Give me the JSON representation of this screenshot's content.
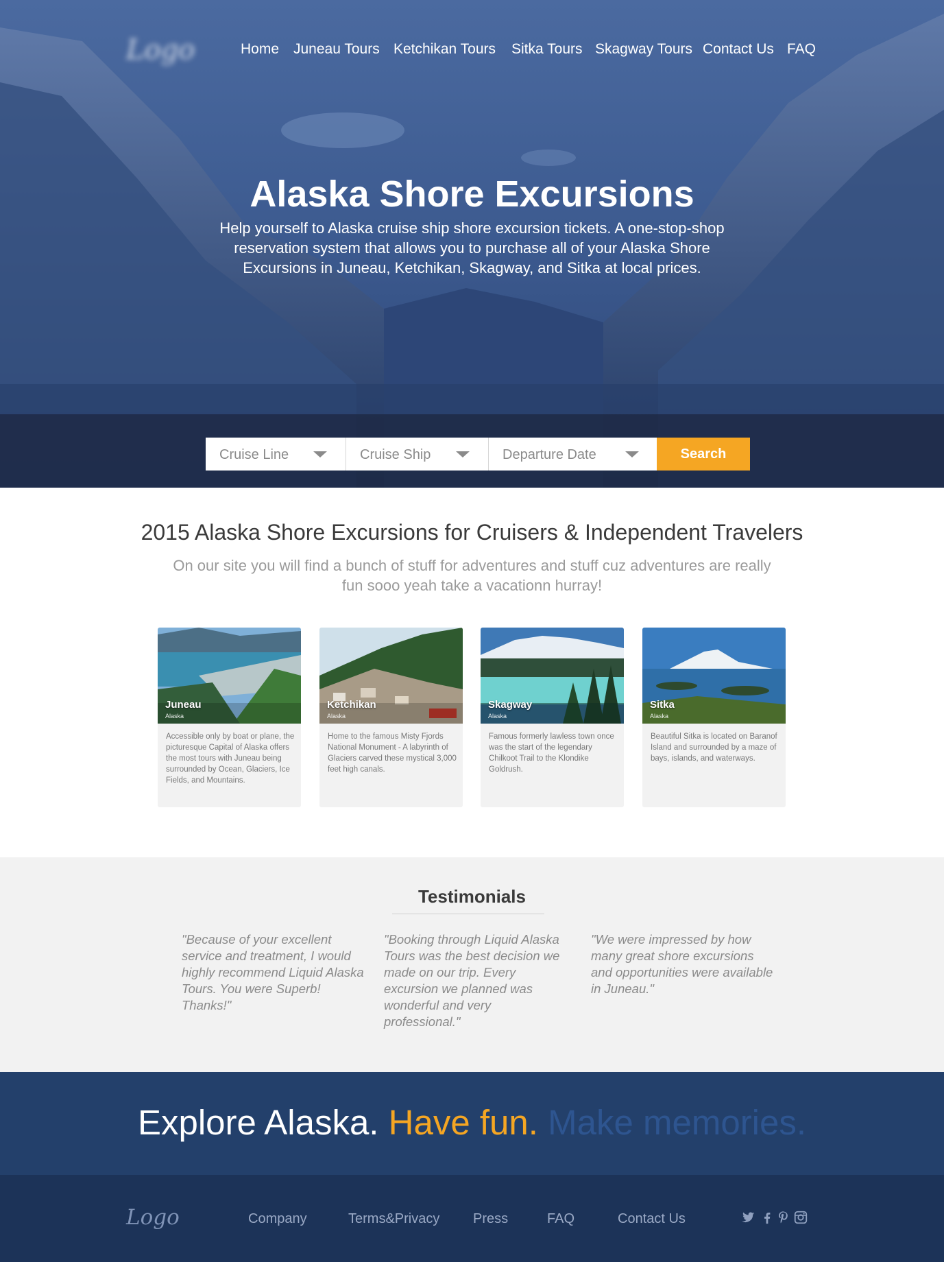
{
  "logo_text": "Logo",
  "nav": {
    "items": [
      "Home",
      "Juneau Tours",
      "Ketchikan Tours",
      "Sitka Tours",
      "Skagway Tours",
      "Contact Us",
      "FAQ"
    ]
  },
  "hero": {
    "title": "Alaska Shore Excursions",
    "intro": "Help yourself to Alaska cruise ship shore excursion tickets. A one-stop-shop reservation system that allows you to purchase all of your Alaska Shore Excursions in Juneau, Ketchikan, Skagway, and Sitka at local prices."
  },
  "search": {
    "cruise_line": "Cruise Line",
    "cruise_ship": "Cruise Ship",
    "departure_date": "Departure Date",
    "button": "Search"
  },
  "section": {
    "title": "2015 Alaska Shore Excursions for Cruisers & Independent Travelers",
    "subtitle": "On our site you will find a bunch of stuff for adventures and stuff cuz adventures are really fun sooo yeah take a vacationn hurray!"
  },
  "cards": [
    {
      "city": "Juneau",
      "state": "Alaska",
      "desc": "Accessible only by boat or plane, the picturesque Capital of Alaska offers the most tours with Juneau being surrounded by Ocean, Glaciers, Ice Fields, and Mountains."
    },
    {
      "city": "Ketchikan",
      "state": "Alaska",
      "desc": "Home to the famous Misty Fjords National Monument -  A labyrinth of Glaciers carved these mystical 3,000 feet high canals."
    },
    {
      "city": "Skagway",
      "state": "Alaska",
      "desc": "Famous formerly lawless town once was the start of the legendary Chilkoot Trail to the Klondike Goldrush."
    },
    {
      "city": "Sitka",
      "state": "Alaska",
      "desc": "Beautiful Sitka is located on Baranof Island and surrounded by a maze of bays, islands, and waterways."
    }
  ],
  "testimonials": {
    "title": "Testimonials",
    "quotes": [
      "\"Because of your excellent service and treatment, I would highly recommend Liquid Alaska Tours. You were Superb! Thanks!\"",
      "\"Booking through Liquid Alaska Tours was the best decision we made on our trip. Every excursion we planned was wonderful and very professional.\"",
      "\"We were impressed by how many great shore excursions and opportunities were available in Juneau.\""
    ]
  },
  "explore": {
    "part1": "Explore Alaska.",
    "part2": "Have fun.",
    "part3": "Make memories."
  },
  "footer": {
    "logo": "Logo",
    "links": [
      "Company",
      "Terms&Privacy",
      "Press",
      "FAQ",
      "Contact Us"
    ],
    "social_icons": [
      "twitter-icon",
      "facebook-icon",
      "pinterest-icon",
      "instagram-icon"
    ]
  },
  "colors": {
    "accent_orange": "#f5a623",
    "navy": "#23406b",
    "footer_navy": "#1c3358",
    "hero_blue": "#3e5a8c"
  }
}
